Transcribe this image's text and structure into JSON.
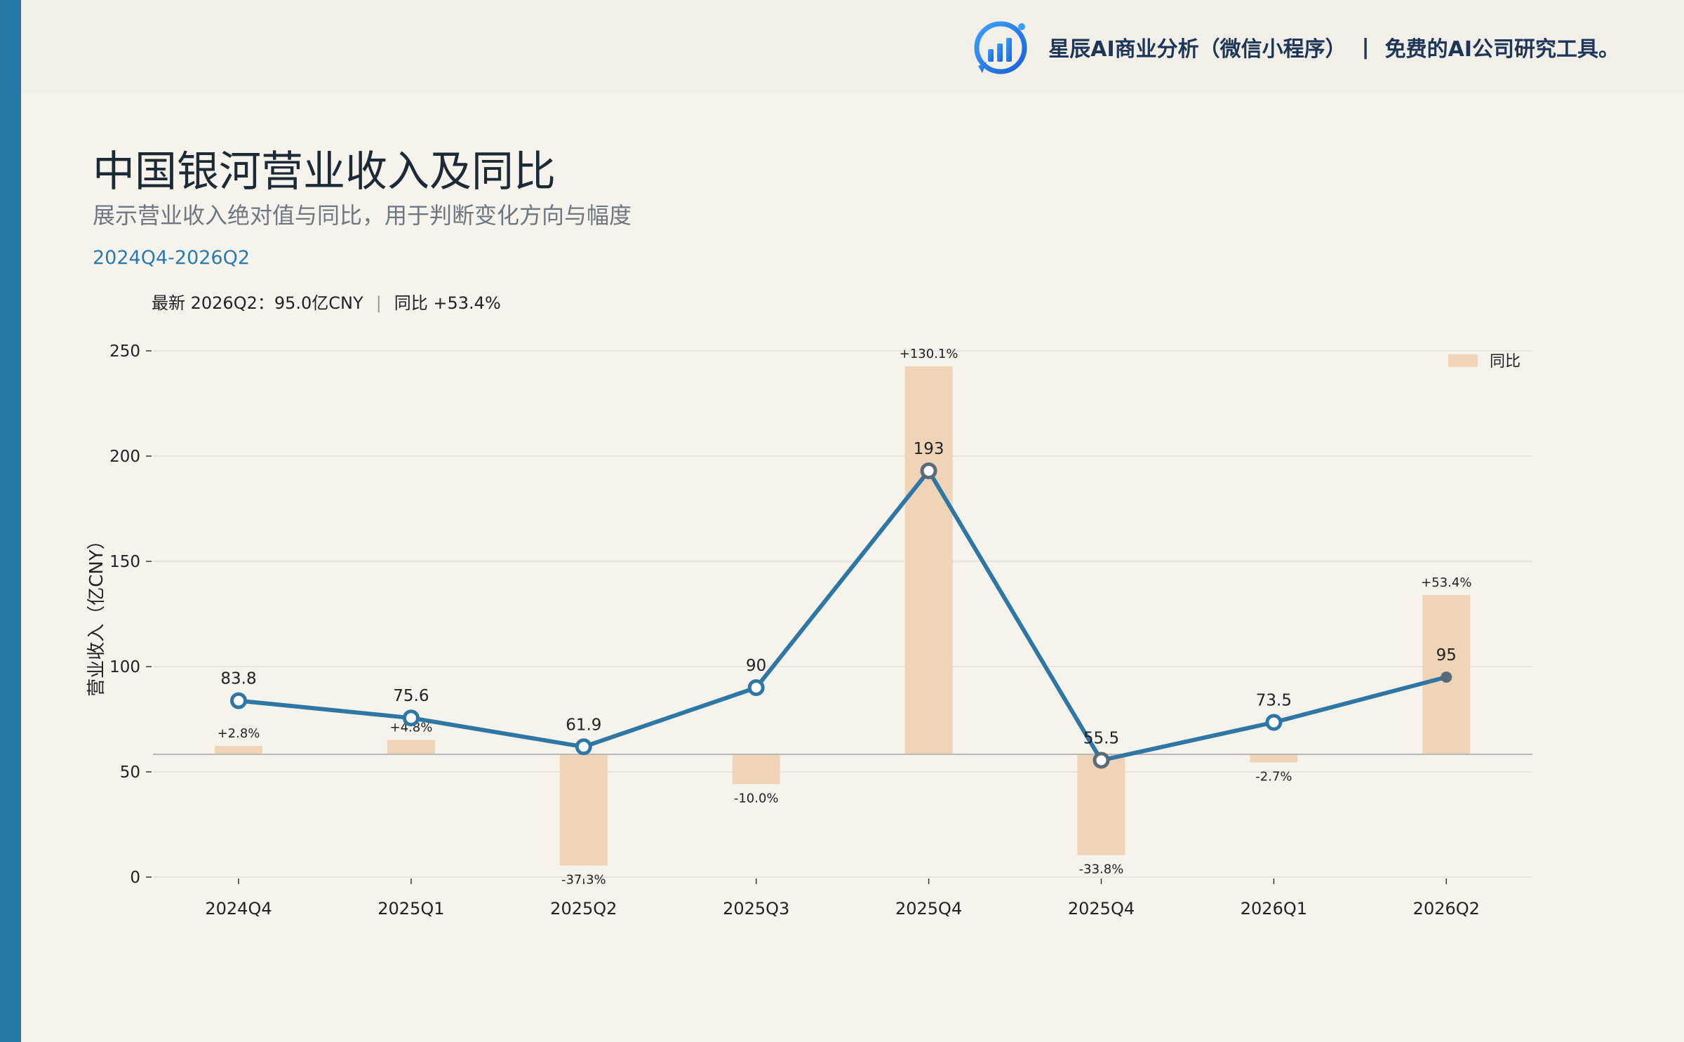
{
  "header": {
    "brand_name": "星辰AI商业分析（微信小程序）",
    "separator": "|",
    "tagline": "免费的AI公司研究工具。",
    "logo_icon": "bar-chart-logo-icon"
  },
  "title": "中国银河营业收入及同比",
  "subtitle": "展示营业收入绝对值与同比，用于判断变化方向与幅度",
  "range": "2024Q4-2026Q2",
  "latest": {
    "label": "最新 2026Q2：95.0亿CNY",
    "separator": "|",
    "yoy": "同比 +53.4%"
  },
  "colors": {
    "line": "#2e77a5",
    "bar": "#efd4b8",
    "accent": "#2878a6",
    "last_point": "#5a6b76"
  },
  "chart_data": {
    "type": "bar+line",
    "categories": [
      "2024Q4",
      "2025Q1",
      "2025Q2",
      "2025Q3",
      "2025Q4",
      "2025Q4",
      "2026Q1",
      "2026Q2"
    ],
    "ylabel": "营业收入（亿CNY）",
    "ylim": [
      0,
      250
    ],
    "yticks": [
      "0",
      "50",
      "100",
      "150",
      "200",
      "250"
    ],
    "grid": true,
    "legend_position": "top-right",
    "series": [
      {
        "type": "line",
        "values": [
          83.8,
          75.6,
          61.9,
          90,
          193,
          55.5,
          73.5,
          95
        ],
        "labels": [
          "83.8",
          "75.6",
          "61.9",
          "90",
          "193",
          "55.5",
          "73.5",
          "95"
        ]
      },
      {
        "type": "bar",
        "name": "同比",
        "values": [
          2.8,
          4.8,
          -37.3,
          -10.0,
          130.1,
          -33.8,
          -2.7,
          53.4
        ],
        "labels": [
          "+2.8%",
          "+4.8%",
          "-37.3%",
          "-10.0%",
          "+130.1%",
          "-33.8%",
          "-2.7%",
          "+53.4%"
        ]
      }
    ]
  }
}
